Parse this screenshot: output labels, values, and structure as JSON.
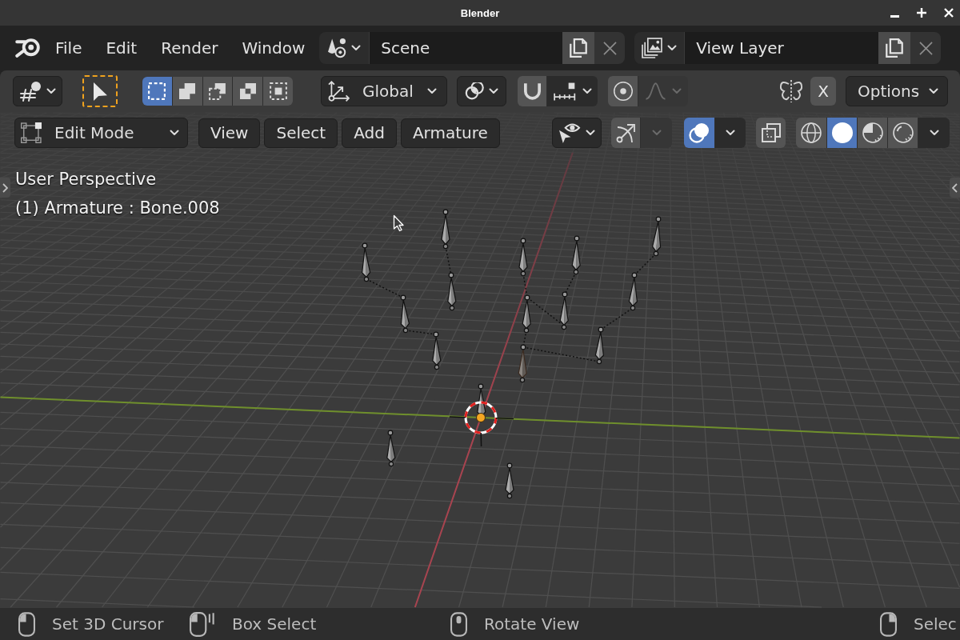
{
  "window": {
    "title": "Blender"
  },
  "top_bar": {
    "menus": [
      "File",
      "Edit",
      "Render",
      "Window"
    ],
    "scene": {
      "value": "Scene"
    },
    "view_layer": {
      "value": "View Layer"
    }
  },
  "tool_header": {
    "select_modes": [
      {
        "kind": "new",
        "selected": true
      },
      {
        "kind": "extend",
        "selected": false
      },
      {
        "kind": "subtract",
        "selected": false
      },
      {
        "kind": "difference",
        "selected": false
      },
      {
        "kind": "intersect",
        "selected": false
      }
    ],
    "orientation": {
      "value": "Global"
    },
    "snap": {
      "on": false
    },
    "proportional_editing": {
      "on": false
    },
    "mirror_axes": [
      {
        "label": "X",
        "on": false
      }
    ],
    "options": {
      "label": "Options"
    }
  },
  "view_header": {
    "mode": {
      "value": "Edit Mode"
    },
    "menus": [
      "View",
      "Select",
      "Add",
      "Armature"
    ],
    "gizmos": {
      "on": false
    },
    "overlays": {
      "on": true
    },
    "xray": {
      "on": false
    },
    "shading_modes": [
      {
        "kind": "wireframe",
        "selected": false
      },
      {
        "kind": "solid",
        "selected": true
      },
      {
        "kind": "material_preview",
        "selected": false
      },
      {
        "kind": "rendered",
        "selected": false
      }
    ]
  },
  "viewport": {
    "overlay_text": [
      "User Perspective",
      "(1) Armature : Bone.008"
    ]
  },
  "status_bar": {
    "hints": [
      {
        "kind": "mouse_left",
        "text": "Set 3D Cursor"
      },
      {
        "kind": "mouse_left_drag",
        "text": "Box Select"
      },
      {
        "kind": "mouse_middle",
        "text": "Rotate View"
      },
      {
        "kind": "mouse_right",
        "text": "Selec"
      }
    ]
  }
}
